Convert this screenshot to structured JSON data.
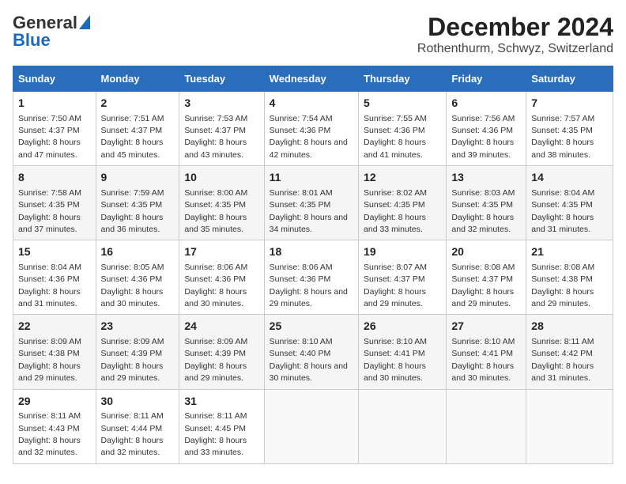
{
  "logo": {
    "general": "General",
    "blue": "Blue"
  },
  "title": "December 2024",
  "subtitle": "Rothenthurm, Schwyz, Switzerland",
  "headers": [
    "Sunday",
    "Monday",
    "Tuesday",
    "Wednesday",
    "Thursday",
    "Friday",
    "Saturday"
  ],
  "weeks": [
    [
      {
        "day": "1",
        "sunrise": "7:50 AM",
        "sunset": "4:37 PM",
        "daylight": "8 hours and 47 minutes."
      },
      {
        "day": "2",
        "sunrise": "7:51 AM",
        "sunset": "4:37 PM",
        "daylight": "8 hours and 45 minutes."
      },
      {
        "day": "3",
        "sunrise": "7:53 AM",
        "sunset": "4:37 PM",
        "daylight": "8 hours and 43 minutes."
      },
      {
        "day": "4",
        "sunrise": "7:54 AM",
        "sunset": "4:36 PM",
        "daylight": "8 hours and 42 minutes."
      },
      {
        "day": "5",
        "sunrise": "7:55 AM",
        "sunset": "4:36 PM",
        "daylight": "8 hours and 41 minutes."
      },
      {
        "day": "6",
        "sunrise": "7:56 AM",
        "sunset": "4:36 PM",
        "daylight": "8 hours and 39 minutes."
      },
      {
        "day": "7",
        "sunrise": "7:57 AM",
        "sunset": "4:35 PM",
        "daylight": "8 hours and 38 minutes."
      }
    ],
    [
      {
        "day": "8",
        "sunrise": "7:58 AM",
        "sunset": "4:35 PM",
        "daylight": "8 hours and 37 minutes."
      },
      {
        "day": "9",
        "sunrise": "7:59 AM",
        "sunset": "4:35 PM",
        "daylight": "8 hours and 36 minutes."
      },
      {
        "day": "10",
        "sunrise": "8:00 AM",
        "sunset": "4:35 PM",
        "daylight": "8 hours and 35 minutes."
      },
      {
        "day": "11",
        "sunrise": "8:01 AM",
        "sunset": "4:35 PM",
        "daylight": "8 hours and 34 minutes."
      },
      {
        "day": "12",
        "sunrise": "8:02 AM",
        "sunset": "4:35 PM",
        "daylight": "8 hours and 33 minutes."
      },
      {
        "day": "13",
        "sunrise": "8:03 AM",
        "sunset": "4:35 PM",
        "daylight": "8 hours and 32 minutes."
      },
      {
        "day": "14",
        "sunrise": "8:04 AM",
        "sunset": "4:35 PM",
        "daylight": "8 hours and 31 minutes."
      }
    ],
    [
      {
        "day": "15",
        "sunrise": "8:04 AM",
        "sunset": "4:36 PM",
        "daylight": "8 hours and 31 minutes."
      },
      {
        "day": "16",
        "sunrise": "8:05 AM",
        "sunset": "4:36 PM",
        "daylight": "8 hours and 30 minutes."
      },
      {
        "day": "17",
        "sunrise": "8:06 AM",
        "sunset": "4:36 PM",
        "daylight": "8 hours and 30 minutes."
      },
      {
        "day": "18",
        "sunrise": "8:06 AM",
        "sunset": "4:36 PM",
        "daylight": "8 hours and 29 minutes."
      },
      {
        "day": "19",
        "sunrise": "8:07 AM",
        "sunset": "4:37 PM",
        "daylight": "8 hours and 29 minutes."
      },
      {
        "day": "20",
        "sunrise": "8:08 AM",
        "sunset": "4:37 PM",
        "daylight": "8 hours and 29 minutes."
      },
      {
        "day": "21",
        "sunrise": "8:08 AM",
        "sunset": "4:38 PM",
        "daylight": "8 hours and 29 minutes."
      }
    ],
    [
      {
        "day": "22",
        "sunrise": "8:09 AM",
        "sunset": "4:38 PM",
        "daylight": "8 hours and 29 minutes."
      },
      {
        "day": "23",
        "sunrise": "8:09 AM",
        "sunset": "4:39 PM",
        "daylight": "8 hours and 29 minutes."
      },
      {
        "day": "24",
        "sunrise": "8:09 AM",
        "sunset": "4:39 PM",
        "daylight": "8 hours and 29 minutes."
      },
      {
        "day": "25",
        "sunrise": "8:10 AM",
        "sunset": "4:40 PM",
        "daylight": "8 hours and 30 minutes."
      },
      {
        "day": "26",
        "sunrise": "8:10 AM",
        "sunset": "4:41 PM",
        "daylight": "8 hours and 30 minutes."
      },
      {
        "day": "27",
        "sunrise": "8:10 AM",
        "sunset": "4:41 PM",
        "daylight": "8 hours and 30 minutes."
      },
      {
        "day": "28",
        "sunrise": "8:11 AM",
        "sunset": "4:42 PM",
        "daylight": "8 hours and 31 minutes."
      }
    ],
    [
      {
        "day": "29",
        "sunrise": "8:11 AM",
        "sunset": "4:43 PM",
        "daylight": "8 hours and 32 minutes."
      },
      {
        "day": "30",
        "sunrise": "8:11 AM",
        "sunset": "4:44 PM",
        "daylight": "8 hours and 32 minutes."
      },
      {
        "day": "31",
        "sunrise": "8:11 AM",
        "sunset": "4:45 PM",
        "daylight": "8 hours and 33 minutes."
      },
      null,
      null,
      null,
      null
    ]
  ]
}
